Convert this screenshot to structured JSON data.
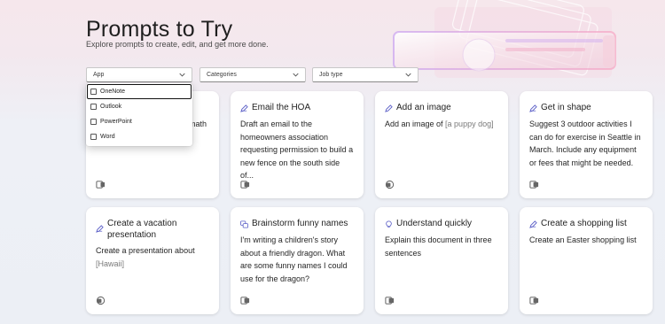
{
  "page": {
    "title": "Prompts to Try",
    "subtitle": "Explore prompts to create, edit, and get more done."
  },
  "filters": [
    {
      "label": "App"
    },
    {
      "label": "Categories"
    },
    {
      "label": "Job type"
    }
  ],
  "app_dropdown": {
    "options": [
      {
        "label": "OneNote",
        "checked": false,
        "focused": true
      },
      {
        "label": "Outlook",
        "checked": false,
        "focused": false
      },
      {
        "label": "PowerPoint",
        "checked": false,
        "focused": false
      },
      {
        "label": "Word",
        "checked": false,
        "focused": false
      }
    ]
  },
  "cards": [
    {
      "title": "",
      "body": "math",
      "icon": "app-icon",
      "title_icon": ""
    },
    {
      "title": "Email the HOA",
      "body": "Draft an email to the homeowners association requesting permission to build a new fence on the south side of...",
      "title_icon": "pen-icon",
      "icon": "outlook-icon"
    },
    {
      "title": "Add an image",
      "body": "Add an image of ",
      "placeholder": "[a puppy dog]",
      "title_icon": "pencil-icon",
      "icon": "powerpoint-icon"
    },
    {
      "title": "Get in shape",
      "body": "Suggest 3 outdoor activities I can do for exercise in Seattle in March. Include any equipment or fees that might be needed.",
      "title_icon": "pen-icon",
      "icon": "onenote-icon"
    },
    {
      "title": "Create a vacation presentation",
      "body": "Create a presentation about ",
      "placeholder": "[Hawaii]",
      "title_icon": "pen-icon",
      "icon": "powerpoint-icon"
    },
    {
      "title": "Brainstorm funny names",
      "body": "I'm writing a children's story about a friendly dragon. What are some funny names I could use for the dragon?",
      "title_icon": "chat-icon",
      "icon": "word-icon"
    },
    {
      "title": "Understand quickly",
      "body": "Explain this document in three sentences",
      "title_icon": "lightbulb-icon",
      "icon": "word-icon"
    },
    {
      "title": "Create a shopping list",
      "body": "Create an Easter shopping list",
      "title_icon": "pen-icon",
      "icon": "word-icon"
    }
  ],
  "colors": {
    "accent": "#5b5fc7",
    "background_top": "#f6e7ec",
    "background_bottom": "#eceff5"
  }
}
